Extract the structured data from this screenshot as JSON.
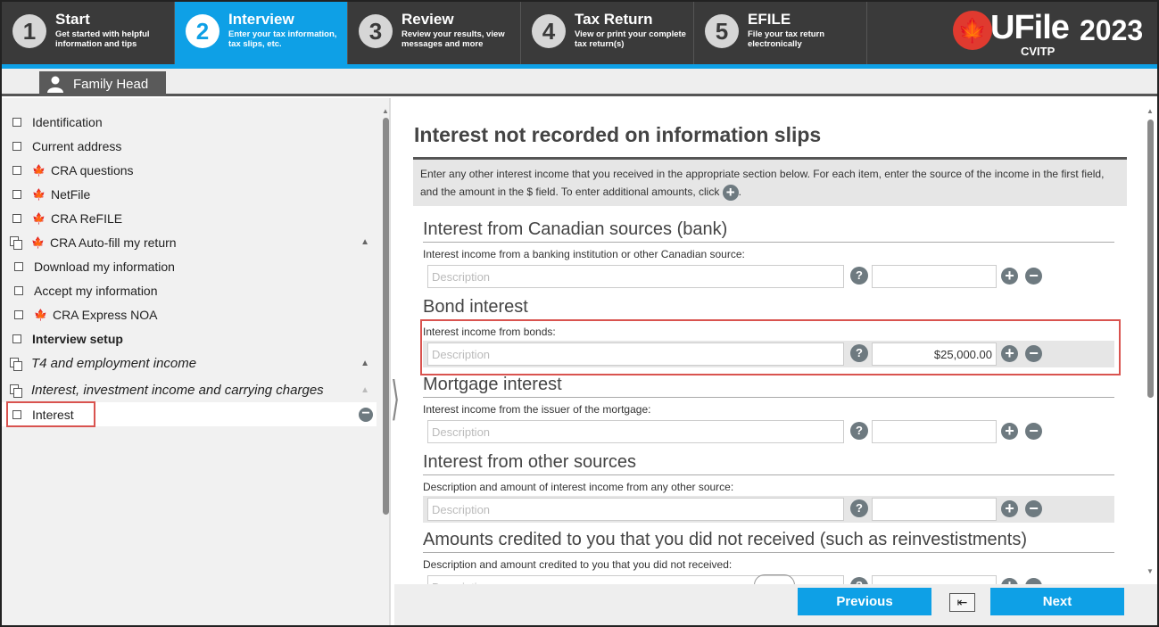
{
  "steps": [
    {
      "num": "1",
      "title": "Start",
      "desc": "Get started with helpful information and tips"
    },
    {
      "num": "2",
      "title": "Interview",
      "desc": "Enter your tax information, tax slips, etc."
    },
    {
      "num": "3",
      "title": "Review",
      "desc": "Review your results, view messages and more"
    },
    {
      "num": "4",
      "title": "Tax Return",
      "desc": "View or print your complete tax return(s)"
    },
    {
      "num": "5",
      "title": "EFILE",
      "desc": "File your tax return electronically"
    }
  ],
  "logo": {
    "brand": "UFile",
    "sub": "CVITP",
    "year": "2023"
  },
  "family_tab": "Family Head",
  "sidebar": {
    "items": [
      {
        "label": "Identification"
      },
      {
        "label": "Current address"
      },
      {
        "label": "CRA questions"
      },
      {
        "label": "NetFile"
      },
      {
        "label": "CRA ReFILE"
      },
      {
        "label": "CRA Auto-fill my return"
      },
      {
        "label": "Download my information"
      },
      {
        "label": "Accept my information"
      },
      {
        "label": "CRA Express NOA"
      },
      {
        "label": "Interview setup"
      },
      {
        "label": "T4 and employment income"
      },
      {
        "label": "Interest, investment income and carrying charges"
      },
      {
        "label": "Interest"
      }
    ]
  },
  "main": {
    "title": "Interest not recorded on information slips",
    "intro": "Enter any other interest income that you received in the appropriate section below. For each item, enter the source of the income in the first field, and the amount in the $ field. To enter additional amounts, click",
    "intro_end": ".",
    "placeholder": "Description",
    "sections": [
      {
        "head": "Interest from Canadian sources (bank)",
        "label": "Interest income from a banking institution or other Canadian source:",
        "amount": ""
      },
      {
        "head": "Bond interest",
        "label": "Interest income from bonds:",
        "amount": "$25,000.00"
      },
      {
        "head": "Mortgage interest",
        "label": "Interest income from the issuer of the mortgage:",
        "amount": ""
      },
      {
        "head": "Interest from other sources",
        "label": "Description and amount of interest income from any other source:",
        "amount": ""
      },
      {
        "head": "Amounts credited to you that you did not received (such as reinvestistments)",
        "label": "Description and amount credited to you that you did not received:",
        "amount": ""
      }
    ]
  },
  "footer": {
    "previous": "Previous",
    "back": "⇤",
    "next": "Next"
  },
  "icons": {
    "help": "?",
    "plus": "+",
    "minus": "−",
    "leaf": "🍁"
  },
  "colors": {
    "accent": "#0ea0e6",
    "nav_bg": "#3a3a3a",
    "highlight": "#d9534f"
  }
}
